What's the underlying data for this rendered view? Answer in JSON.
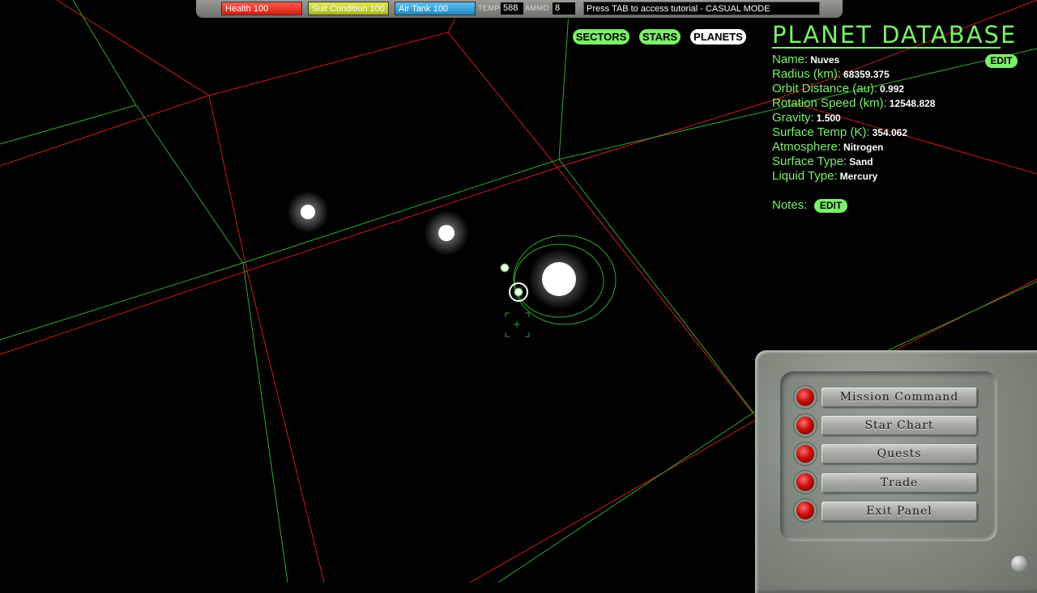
{
  "hud": {
    "health": "Health 100",
    "suit": "Suit Condition 100",
    "air": "Air Tank 100",
    "temp_label": "TEMP",
    "temp_value": "588",
    "ammo_label": "AMMO",
    "ammo_value": "8",
    "message": "Press TAB to access tutorial - CASUAL MODE"
  },
  "tabs": {
    "sectors": "SECTORS",
    "stars": "STARS",
    "planets": "PLANETS",
    "active": "planets"
  },
  "database": {
    "title": "PLANET DATABASE",
    "edit_label": "EDIT",
    "fields": [
      {
        "label": "Name:",
        "value": "Nuves"
      },
      {
        "label": "Radius (km):",
        "value": "68359.375"
      },
      {
        "label": "Orbit Distance (au):",
        "value": "0.992"
      },
      {
        "label": "Rotation Speed (km):",
        "value": "12548.828"
      },
      {
        "label": "Gravity:",
        "value": "1.500"
      },
      {
        "label": "Surface Temp (K):",
        "value": "354.062"
      },
      {
        "label": "Atmosphere:",
        "value": "Nitrogen"
      },
      {
        "label": "Surface Type:",
        "value": "Sand"
      },
      {
        "label": "Liquid Type:",
        "value": "Mercury"
      }
    ],
    "notes_label": "Notes:",
    "notes_edit_label": "EDIT"
  },
  "panel": {
    "buttons": [
      "Mission Command",
      "Star Chart",
      "Quests",
      "Trade",
      "Exit Panel"
    ]
  },
  "colors": {
    "accent_green": "#7cf06a",
    "grid_red": "#d11a1a",
    "grid_green": "#2fa82f",
    "health": "#e0291c",
    "suit": "#c4cf2a",
    "air": "#2a9fd6"
  }
}
